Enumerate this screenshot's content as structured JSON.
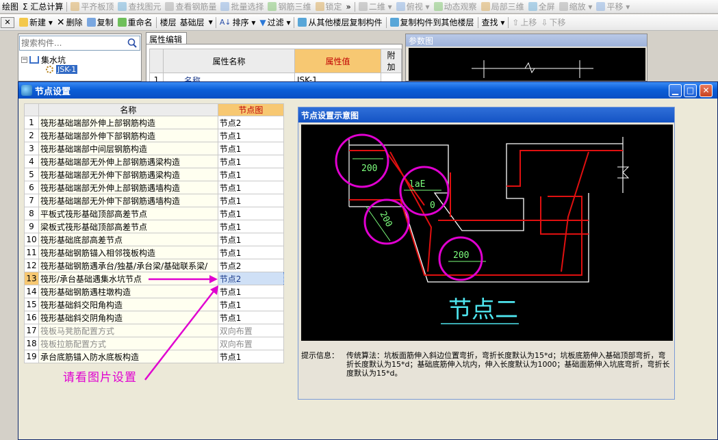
{
  "toolbar_top": {
    "items": [
      {
        "label": "绘图",
        "dim": false
      },
      {
        "label": "Σ 汇总计算",
        "dim": false
      },
      {
        "label": "平齐板顶",
        "dim": true
      },
      {
        "label": "查找图元",
        "dim": true
      },
      {
        "label": "查看钢筋量",
        "dim": true
      },
      {
        "label": "批量选择",
        "dim": true
      },
      {
        "label": "钢筋三维",
        "dim": true
      },
      {
        "label": "锁定",
        "dim": true
      },
      {
        "label": "»",
        "dim": false
      },
      {
        "label": "二维 ▾",
        "dim": true
      },
      {
        "label": "俯视 ▾",
        "dim": true
      },
      {
        "label": "动态观察",
        "dim": true
      },
      {
        "label": "局部三维",
        "dim": true
      },
      {
        "label": "全屏",
        "dim": true
      },
      {
        "label": "缩放 ▾",
        "dim": true
      },
      {
        "label": "平移 ▾",
        "dim": true
      }
    ]
  },
  "toolbar_main": {
    "close_glyph": "✕",
    "new_label": "新建 ▾",
    "delete_label": "删除",
    "copy_label": "复制",
    "rename_label": "重命名",
    "floor_label": "楼层",
    "floor_value": "基础层",
    "sort_label": "排序 ▾",
    "filter_label": "过滤 ▾",
    "copy_from_label": "从其他楼层复制构件",
    "copy_to_label": "复制构件到其他楼层",
    "find_label": "查找 ▾",
    "move_up_label": "上移",
    "move_down_label": "下移"
  },
  "component_panel": {
    "search_placeholder": "搜索构件...",
    "tree_root": "集水坑",
    "tree_child": "JSK-1"
  },
  "property_editor": {
    "tab_label": "属性编辑",
    "col_name": "属性名称",
    "col_value": "属性值",
    "col_extra": "附加",
    "rows": [
      {
        "index": "1",
        "name": "名称",
        "value": "JSK-1"
      }
    ]
  },
  "param_panel": {
    "title": "参数图"
  },
  "dialog": {
    "title": "节点设置",
    "col_name": "名称",
    "col_node": "节点图",
    "rows": [
      {
        "index": "1",
        "name": "筏形基础端部外伸上部钢筋构造",
        "node": "节点2",
        "gray": false
      },
      {
        "index": "2",
        "name": "筏形基础端部外伸下部钢筋构造",
        "node": "节点1",
        "gray": false
      },
      {
        "index": "3",
        "name": "筏形基础端部中间层钢筋构造",
        "node": "节点1",
        "gray": false
      },
      {
        "index": "4",
        "name": "筏形基础端部无外伸上部钢筋遇梁构造",
        "node": "节点1",
        "gray": false
      },
      {
        "index": "5",
        "name": "筏形基础端部无外伸下部钢筋遇梁构造",
        "node": "节点1",
        "gray": false
      },
      {
        "index": "6",
        "name": "筏形基础端部无外伸上部钢筋遇墙构造",
        "node": "节点1",
        "gray": false
      },
      {
        "index": "7",
        "name": "筏形基础端部无外伸下部钢筋遇墙构造",
        "node": "节点1",
        "gray": false
      },
      {
        "index": "8",
        "name": "平板式筏形基础顶部高差节点",
        "node": "节点1",
        "gray": false
      },
      {
        "index": "9",
        "name": "梁板式筏形基础顶部高差节点",
        "node": "节点1",
        "gray": false
      },
      {
        "index": "10",
        "name": "筏形基础底部高差节点",
        "node": "节点1",
        "gray": false
      },
      {
        "index": "11",
        "name": "筏形基础钢筋锚入相邻筏板构造",
        "node": "节点1",
        "gray": false
      },
      {
        "index": "12",
        "name": "筏形基础钢筋遇承台/独基/承台梁/基础联系梁/",
        "node": "节点2",
        "gray": false
      },
      {
        "index": "13",
        "name": "筏形/承台基础遇集水坑节点",
        "node": "节点2",
        "gray": false,
        "selected": true
      },
      {
        "index": "14",
        "name": "筏形基础钢筋遇柱墩构造",
        "node": "节点1",
        "gray": false
      },
      {
        "index": "15",
        "name": "筏形基础斜交阳角构造",
        "node": "节点1",
        "gray": false
      },
      {
        "index": "16",
        "name": "筏形基础斜交阴角构造",
        "node": "节点1",
        "gray": false
      },
      {
        "index": "17",
        "name": "筏板马凳筋配置方式",
        "node": "双向布置",
        "gray": true
      },
      {
        "index": "18",
        "name": "筏板拉筋配置方式",
        "node": "双向布置",
        "gray": true
      },
      {
        "index": "19",
        "name": "承台底筋锚入防水底板构造",
        "node": "节点1",
        "gray": false
      }
    ],
    "diagram": {
      "group_title": "节点设置示意图",
      "dim_200_a": "200",
      "dim_lae": "laE",
      "dim_0": "0",
      "dim_200_b": "200",
      "dim_200_c": "200",
      "caption": "节点二"
    },
    "hint_label": "提示信息：",
    "hint_text": "传统算法：坑板面筋伸入斜边位置弯折，弯折长度默认为15*d；坑板底筋伸入基础顶部弯折，弯折长度默认为15*d；基础底筋伸入坑内，伸入长度默认为1000；基础面筋伸入坑底弯折，弯折长度默认为15*d。"
  },
  "annotation": "请看图片设置",
  "colors": {
    "title_blue": "#0b5fd8",
    "header_orange": "#f7c872",
    "rebar_red": "#e01010",
    "dim_green": "#7dff7d",
    "circle_magenta": "#e000d0",
    "caption_cyan": "#4ee4ee"
  }
}
